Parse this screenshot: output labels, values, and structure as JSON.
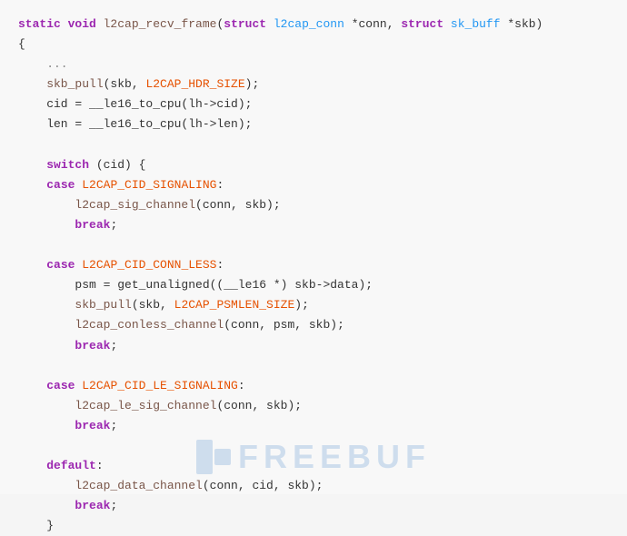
{
  "code": {
    "lines": [
      {
        "id": "l1",
        "parts": [
          {
            "text": "static ",
            "cls": "kw"
          },
          {
            "text": "void ",
            "cls": "kw"
          },
          {
            "text": "l2cap_recv_frame",
            "cls": "fn"
          },
          {
            "text": "(",
            "cls": "plain"
          },
          {
            "text": "struct ",
            "cls": "kw"
          },
          {
            "text": "l2cap_conn ",
            "cls": "type"
          },
          {
            "text": "*conn, ",
            "cls": "plain"
          },
          {
            "text": "struct ",
            "cls": "kw"
          },
          {
            "text": "sk_buff ",
            "cls": "type"
          },
          {
            "text": "*skb)",
            "cls": "plain"
          }
        ]
      },
      {
        "id": "l2",
        "parts": [
          {
            "text": "{",
            "cls": "plain"
          }
        ]
      },
      {
        "id": "l3",
        "parts": [
          {
            "text": "    ...",
            "cls": "comment"
          }
        ]
      },
      {
        "id": "l4",
        "parts": [
          {
            "text": "    skb_pull",
            "cls": "fn"
          },
          {
            "text": "(skb, ",
            "cls": "plain"
          },
          {
            "text": "L2CAP_HDR_SIZE",
            "cls": "macro"
          },
          {
            "text": ");",
            "cls": "plain"
          }
        ]
      },
      {
        "id": "l5",
        "parts": [
          {
            "text": "    cid = __le16_to_cpu(lh->cid);",
            "cls": "plain"
          }
        ]
      },
      {
        "id": "l6",
        "parts": [
          {
            "text": "    len = __le16_to_cpu(lh->len);",
            "cls": "plain"
          }
        ]
      },
      {
        "id": "l7",
        "parts": [
          {
            "text": "",
            "cls": "plain"
          }
        ]
      },
      {
        "id": "l8",
        "parts": [
          {
            "text": "    ",
            "cls": "plain"
          },
          {
            "text": "switch",
            "cls": "kw"
          },
          {
            "text": " (cid) {",
            "cls": "plain"
          }
        ]
      },
      {
        "id": "l9",
        "parts": [
          {
            "text": "    ",
            "cls": "plain"
          },
          {
            "text": "case ",
            "cls": "kw"
          },
          {
            "text": "L2CAP_CID_SIGNALING",
            "cls": "macro"
          },
          {
            "text": ":",
            "cls": "plain"
          }
        ]
      },
      {
        "id": "l10",
        "parts": [
          {
            "text": "        l2cap_sig_channel",
            "cls": "fn"
          },
          {
            "text": "(conn, skb);",
            "cls": "plain"
          }
        ]
      },
      {
        "id": "l11",
        "parts": [
          {
            "text": "        ",
            "cls": "plain"
          },
          {
            "text": "break",
            "cls": "kw"
          },
          {
            "text": ";",
            "cls": "plain"
          }
        ]
      },
      {
        "id": "l12",
        "parts": [
          {
            "text": "",
            "cls": "plain"
          }
        ]
      },
      {
        "id": "l13",
        "parts": [
          {
            "text": "    ",
            "cls": "plain"
          },
          {
            "text": "case ",
            "cls": "kw"
          },
          {
            "text": "L2CAP_CID_CONN_LESS",
            "cls": "macro"
          },
          {
            "text": ":",
            "cls": "plain"
          }
        ]
      },
      {
        "id": "l14",
        "parts": [
          {
            "text": "        psm = get_unaligned((__le16 *) skb->data);",
            "cls": "plain"
          }
        ]
      },
      {
        "id": "l15",
        "parts": [
          {
            "text": "        skb_pull",
            "cls": "fn"
          },
          {
            "text": "(skb, ",
            "cls": "plain"
          },
          {
            "text": "L2CAP_PSMLEN_SIZE",
            "cls": "macro"
          },
          {
            "text": ");",
            "cls": "plain"
          }
        ]
      },
      {
        "id": "l16",
        "parts": [
          {
            "text": "        l2cap_conless_channel",
            "cls": "fn"
          },
          {
            "text": "(conn, psm, skb);",
            "cls": "plain"
          }
        ]
      },
      {
        "id": "l17",
        "parts": [
          {
            "text": "        ",
            "cls": "plain"
          },
          {
            "text": "break",
            "cls": "kw"
          },
          {
            "text": ";",
            "cls": "plain"
          }
        ]
      },
      {
        "id": "l18",
        "parts": [
          {
            "text": "",
            "cls": "plain"
          }
        ]
      },
      {
        "id": "l19",
        "parts": [
          {
            "text": "    ",
            "cls": "plain"
          },
          {
            "text": "case ",
            "cls": "kw"
          },
          {
            "text": "L2CAP_CID_LE_SIGNALING",
            "cls": "macro"
          },
          {
            "text": ":",
            "cls": "plain"
          }
        ]
      },
      {
        "id": "l20",
        "parts": [
          {
            "text": "        l2cap_le_sig_channel",
            "cls": "fn"
          },
          {
            "text": "(conn, skb);",
            "cls": "plain"
          }
        ]
      },
      {
        "id": "l21",
        "parts": [
          {
            "text": "        ",
            "cls": "plain"
          },
          {
            "text": "break",
            "cls": "kw"
          },
          {
            "text": ";",
            "cls": "plain"
          }
        ]
      },
      {
        "id": "l22",
        "parts": [
          {
            "text": "",
            "cls": "plain"
          }
        ]
      },
      {
        "id": "l23",
        "parts": [
          {
            "text": "    ",
            "cls": "plain"
          },
          {
            "text": "default",
            "cls": "kw"
          },
          {
            "text": ":",
            "cls": "plain"
          }
        ]
      },
      {
        "id": "l24",
        "parts": [
          {
            "text": "        l2cap_data_channel",
            "cls": "fn"
          },
          {
            "text": "(conn, cid, skb);",
            "cls": "plain"
          }
        ]
      },
      {
        "id": "l25",
        "parts": [
          {
            "text": "        ",
            "cls": "plain"
          },
          {
            "text": "break",
            "cls": "kw"
          },
          {
            "text": ";",
            "cls": "plain"
          }
        ]
      },
      {
        "id": "l26",
        "parts": [
          {
            "text": "    }",
            "cls": "plain"
          }
        ]
      }
    ]
  },
  "watermark": {
    "text": "FREEBUF"
  }
}
